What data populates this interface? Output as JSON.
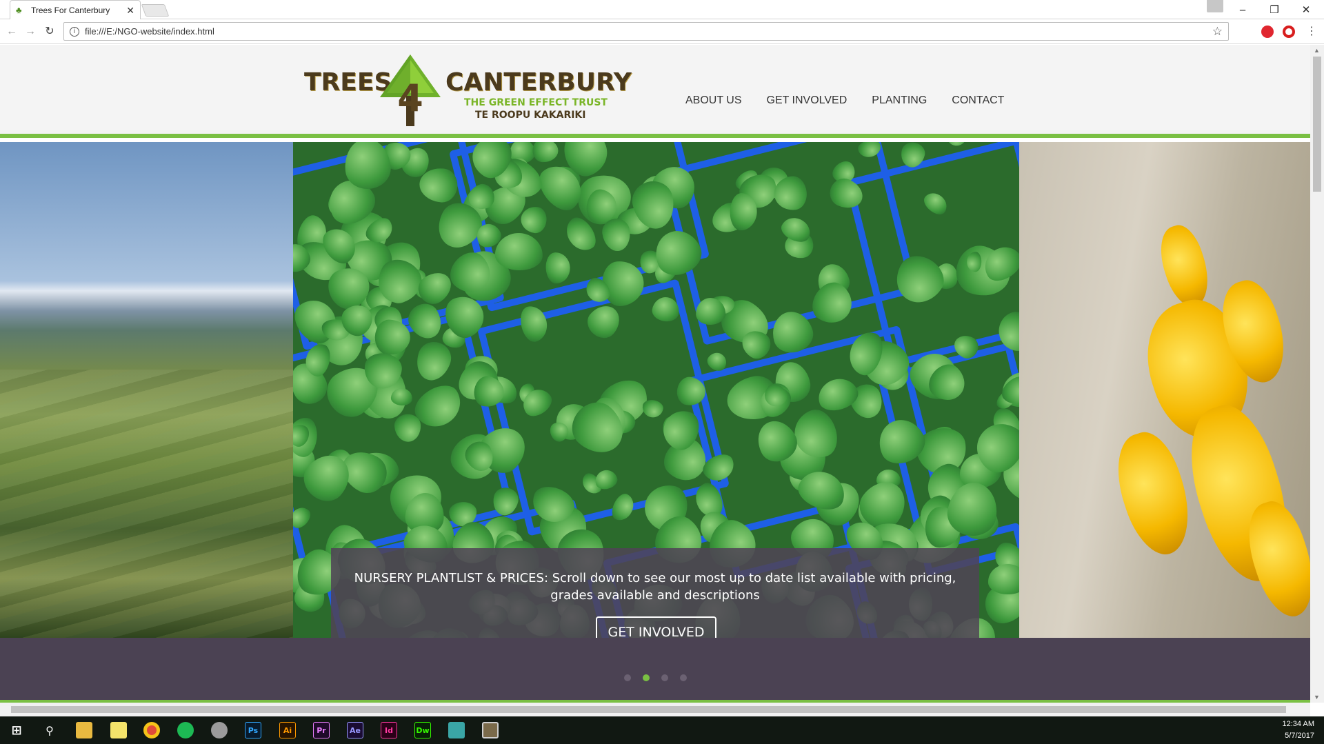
{
  "browser": {
    "tab_title": "Trees For Canterbury",
    "tab_close": "✕",
    "url": "file:///E:/NGO-website/index.html",
    "window_controls": [
      "–",
      "❐",
      "✕"
    ]
  },
  "site": {
    "logo": {
      "word_left": "TREES",
      "digit": "4",
      "word_right": "CANTERBURY",
      "subline_1": "THE GREEN EFFECT TRUST",
      "subline_2": "TE ROOPU KAKARIKI"
    },
    "nav": [
      "ABOUT US",
      "GET INVOLVED",
      "PLANTING",
      "CONTACT"
    ],
    "hero": {
      "caption": "NURSERY PLANTLIST & PRICES: Scroll down to see our most up to date list available with pricing, grades available and descriptions",
      "button": "GET INVOLVED",
      "slide_count": 4,
      "active_slide": 2
    }
  },
  "taskbar": {
    "apps": [
      "start-icon",
      "search-icon",
      "file-explorer-icon",
      "sticky-notes-icon",
      "chrome-icon",
      "spotify-icon",
      "app-icon",
      "photoshop-icon",
      "illustrator-icon",
      "premiere-icon",
      "after-effects-icon",
      "indesign-icon",
      "dreamweaver-icon",
      "app-icon",
      "app-icon"
    ],
    "app_labels": {
      "ps": "Ps",
      "ai": "Ai",
      "pr": "Pr",
      "ae": "Ae",
      "id": "Id",
      "dw": "Dw"
    },
    "time": "12:34 AM",
    "date": "5/7/2017"
  },
  "colors": {
    "accent_green": "#7ac043",
    "footer_band": "#4b4253",
    "caption_bg": "#4f4455",
    "logo_brown": "#4b3a1d"
  }
}
